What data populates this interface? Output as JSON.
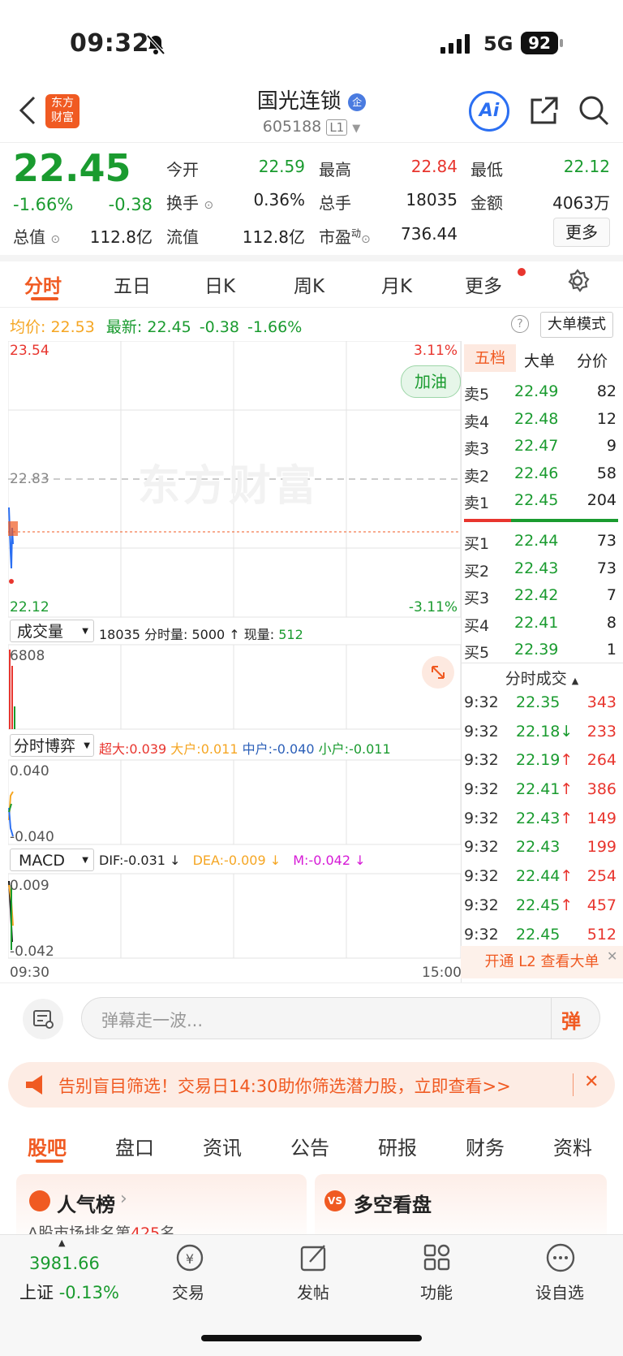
{
  "status": {
    "time": "09:32",
    "network": "5G",
    "battery": "92"
  },
  "header": {
    "title": "国光连锁",
    "badge": "企",
    "code": "605188",
    "level": "L1",
    "logo_top": "东方",
    "logo_bottom": "财富",
    "ai_label": "Ai"
  },
  "quote": {
    "price": "22.45",
    "pct": "-1.66%",
    "change": "-0.38",
    "open_label": "今开",
    "open": "22.59",
    "high_label": "最高",
    "high": "22.84",
    "low_label": "最低",
    "low": "22.12",
    "turnover_label": "换手",
    "turnover": "0.36%",
    "volume_label": "总手",
    "volume": "18035",
    "amount_label": "金额",
    "amount": "4063万",
    "mktcap_label": "总值",
    "mktcap": "112.8亿",
    "float_label": "流值",
    "float": "112.8亿",
    "pe_label": "市盈",
    "pe_sup": "动",
    "pe": "736.44",
    "more_button": "更多"
  },
  "chart_tabs": [
    "分时",
    "五日",
    "日K",
    "周K",
    "月K",
    "更多"
  ],
  "avg_line": {
    "avg_label": "均价:",
    "avg": "22.53",
    "latest_label": "最新:",
    "latest": "22.45",
    "change": "-0.38",
    "pct": "-1.66%",
    "mode_button": "大单模式"
  },
  "intraday": {
    "y_top": "23.54",
    "y_mid": "22.83",
    "y_bottom": "22.12",
    "pct_top": "3.11%",
    "pct_bottom": "-3.11%",
    "watermark": "东方财富",
    "cheer_button": "加油",
    "time_start": "09:30",
    "time_end": "15:00"
  },
  "volume_panel": {
    "selector": "成交量",
    "summary": "18035 分时量: 5000 ↑ 现量:",
    "current": "512",
    "y_top": "6808"
  },
  "game_panel": {
    "selector": "分时博弈",
    "super": "超大:0.039",
    "large": "大户:0.011",
    "mid": "中户:-0.040",
    "small": "小户:-0.011",
    "y_top": "0.040",
    "y_bottom": "-0.040"
  },
  "macd_panel": {
    "selector": "MACD",
    "dif": "DIF:-0.031 ↓",
    "dea": "DEA:-0.009 ↓",
    "m": "M:-0.042 ↓",
    "y_top": "0.009",
    "y_bottom": "-0.042"
  },
  "orderbook": {
    "tabs": [
      "五档",
      "大单",
      "分价"
    ],
    "asks": [
      {
        "label": "卖5",
        "price": "22.49",
        "vol": "82"
      },
      {
        "label": "卖4",
        "price": "22.48",
        "vol": "12"
      },
      {
        "label": "卖3",
        "price": "22.47",
        "vol": "9"
      },
      {
        "label": "卖2",
        "price": "22.46",
        "vol": "58"
      },
      {
        "label": "卖1",
        "price": "22.45",
        "vol": "204"
      }
    ],
    "bids": [
      {
        "label": "买1",
        "price": "22.44",
        "vol": "73"
      },
      {
        "label": "买2",
        "price": "22.43",
        "vol": "73"
      },
      {
        "label": "买3",
        "price": "22.42",
        "vol": "7"
      },
      {
        "label": "买4",
        "price": "22.41",
        "vol": "8"
      },
      {
        "label": "买5",
        "price": "22.39",
        "vol": "1"
      }
    ],
    "ticks_title": "分时成交",
    "ticks": [
      {
        "t": "9:32",
        "p": "22.35",
        "a": "",
        "v": "343"
      },
      {
        "t": "9:32",
        "p": "22.18",
        "a": "↓",
        "v": "233"
      },
      {
        "t": "9:32",
        "p": "22.19",
        "a": "↑",
        "v": "264"
      },
      {
        "t": "9:32",
        "p": "22.41",
        "a": "↑",
        "v": "386"
      },
      {
        "t": "9:32",
        "p": "22.43",
        "a": "↑",
        "v": "149"
      },
      {
        "t": "9:32",
        "p": "22.43",
        "a": "",
        "v": "199"
      },
      {
        "t": "9:32",
        "p": "22.44",
        "a": "↑",
        "v": "254"
      },
      {
        "t": "9:32",
        "p": "22.45",
        "a": "↑",
        "v": "457"
      },
      {
        "t": "9:32",
        "p": "22.45",
        "a": "",
        "v": "512"
      }
    ],
    "l2_banner": "开通 L2 查看大单"
  },
  "danmaku": {
    "placeholder": "弹幕走一波...",
    "send": "弹"
  },
  "promo": {
    "text": "告别盲目筛选！交易日14:30助你筛选潜力股，立即查看>>"
  },
  "bottom_tabs": [
    "股吧",
    "盘口",
    "资讯",
    "公告",
    "研报",
    "财务",
    "资料"
  ],
  "cards": {
    "popular_title": "人气榜",
    "popular_sub_prefix": "A股市场排名第",
    "popular_rank": "425",
    "popular_sub_suffix": "名",
    "vs_title": "多空看盘",
    "vs_icon": "VS"
  },
  "tabbar": {
    "index_value": "3981.66",
    "index_name": "上证",
    "index_pct": "-0.13%",
    "trade": "交易",
    "post": "发帖",
    "func": "功能",
    "watch": "设自选"
  },
  "colors": {
    "up": "#e8352e",
    "down": "#1a9b2f",
    "accent": "#f05a22",
    "avg": "#f5a623"
  }
}
